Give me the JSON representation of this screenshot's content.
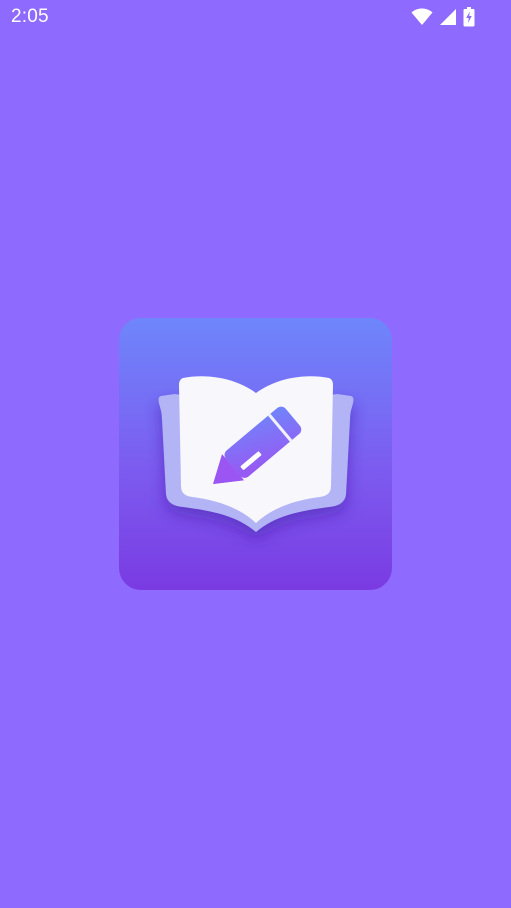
{
  "status_bar": {
    "time": "2:05",
    "icons": [
      "wifi-icon",
      "cellular-signal-icon",
      "battery-charging-icon"
    ]
  },
  "splash": {
    "logo_icon": "book-with-pencil-icon"
  },
  "colors": {
    "background": "#8f6afe",
    "icon_gradient_top": "#6e86fb",
    "icon_gradient_bottom": "#7a3be2",
    "status_text": "#ffffff"
  }
}
